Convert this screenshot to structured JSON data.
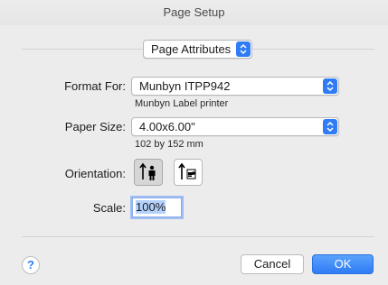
{
  "window": {
    "title": "Page Setup"
  },
  "settings_popup": {
    "value": "Page Attributes"
  },
  "format_for": {
    "label": "Format For:",
    "value": "Munbyn ITPP942",
    "subtitle": "Munbyn Label printer"
  },
  "paper_size": {
    "label": "Paper Size:",
    "value": "4.00x6.00\"",
    "subtitle": "102 by 152 mm"
  },
  "orientation": {
    "label": "Orientation:",
    "options": [
      "portrait",
      "landscape"
    ],
    "selected": "portrait"
  },
  "scale": {
    "label": "Scale:",
    "value": "100%"
  },
  "buttons": {
    "help": "?",
    "cancel": "Cancel",
    "ok": "OK"
  },
  "colors": {
    "accent": "#2f7cf6",
    "background": "#ececec"
  },
  "icons": {
    "stepper": "up-down-chevron-icon",
    "portrait": "portrait-orientation-icon",
    "landscape": "landscape-orientation-icon"
  }
}
